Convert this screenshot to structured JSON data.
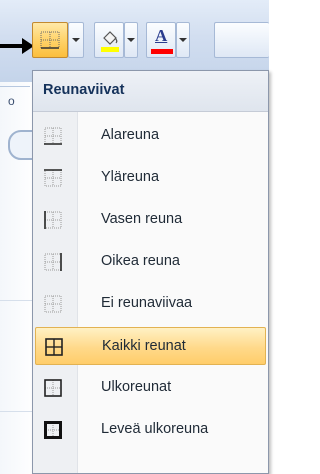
{
  "toolbar": {
    "borders_button": {
      "icon": "borders-grid-icon"
    },
    "fill_color_button": {
      "icon": "fill-color-bucket-icon",
      "color": "#ffff00"
    },
    "font_color_button": {
      "glyph": "A",
      "icon": "font-color-icon",
      "color": "#ff0000"
    }
  },
  "menu": {
    "title": "Reunaviivat",
    "items": [
      {
        "label": "Alareuna",
        "icon": "bottom-border-icon",
        "highlighted": false
      },
      {
        "label": "Yläreuna",
        "icon": "top-border-icon",
        "highlighted": false
      },
      {
        "label": "Vasen reuna",
        "icon": "left-border-icon",
        "highlighted": false
      },
      {
        "label": "Oikea reuna",
        "icon": "right-border-icon",
        "highlighted": false
      },
      {
        "label": "Ei reunaviivaa",
        "icon": "no-border-icon",
        "highlighted": false
      },
      {
        "label": "Kaikki reunat",
        "icon": "all-borders-icon",
        "highlighted": true
      },
      {
        "label": "Ulkoreunat",
        "icon": "outside-borders-icon",
        "highlighted": false
      },
      {
        "label": "Leveä ulkoreuna",
        "icon": "thick-box-border-icon",
        "highlighted": false
      }
    ]
  },
  "background": {
    "tab_letter": "o"
  },
  "colors": {
    "highlight": "#ffd98a",
    "menu_header_text": "#15325b",
    "fill_color": "#ffff00",
    "font_color": "#ff0000"
  }
}
